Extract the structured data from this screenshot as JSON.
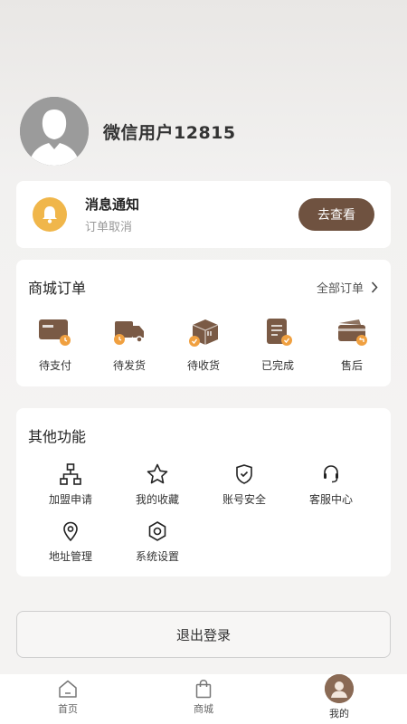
{
  "user": {
    "nickname": "微信用户12815"
  },
  "notice": {
    "title": "消息通知",
    "subtitle": "订单取消",
    "button_label": "去查看"
  },
  "orders": {
    "title": "商城订单",
    "all_label": "全部订单",
    "items": [
      {
        "label": "待支付",
        "icon": "wallet-icon"
      },
      {
        "label": "待发货",
        "icon": "truck-icon"
      },
      {
        "label": "待收货",
        "icon": "package-icon"
      },
      {
        "label": "已完成",
        "icon": "document-check-icon"
      },
      {
        "label": "售后",
        "icon": "card-return-icon"
      }
    ]
  },
  "functions": {
    "title": "其他功能",
    "items": [
      {
        "label": "加盟申请",
        "icon": "org-chart-icon"
      },
      {
        "label": "我的收藏",
        "icon": "star-icon"
      },
      {
        "label": "账号安全",
        "icon": "shield-check-icon"
      },
      {
        "label": "客服中心",
        "icon": "headset-icon"
      },
      {
        "label": "地址管理",
        "icon": "location-pin-icon"
      },
      {
        "label": "系统设置",
        "icon": "settings-hex-icon"
      }
    ]
  },
  "logout_label": "退出登录",
  "tabbar": {
    "items": [
      {
        "label": "首页",
        "icon": "home-icon"
      },
      {
        "label": "商城",
        "icon": "shopping-bag-icon"
      },
      {
        "label": "我的",
        "icon": "user-avatar-icon"
      }
    ],
    "active_index": 2
  },
  "colors": {
    "accent_brown": "#6f5240",
    "icon_brown": "#7a5a45",
    "badge_orange": "#f0a040",
    "bell_yellow": "#f0b64a"
  }
}
